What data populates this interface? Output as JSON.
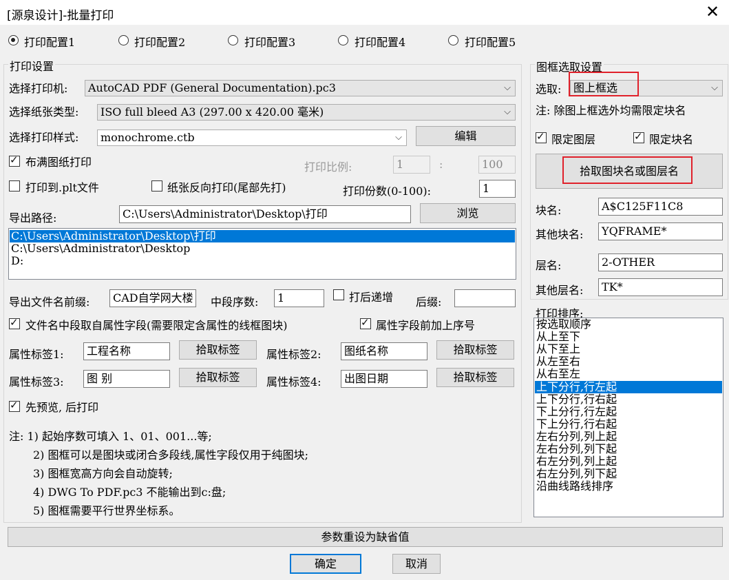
{
  "window": {
    "title": "[源泉设计]-批量打印",
    "close_glyph": "✕"
  },
  "configs": [
    "打印配置1",
    "打印配置2",
    "打印配置3",
    "打印配置4",
    "打印配置5"
  ],
  "print_settings": {
    "title": "打印设置",
    "printer_label": "选择打印机:",
    "printer_value": "AutoCAD PDF (General Documentation).pc3",
    "paper_label": "选择纸张类型:",
    "paper_value": "ISO full bleed A3 (297.00 x 420.00 毫米)",
    "style_label": "选择打印样式:",
    "style_value": "monochrome.ctb",
    "edit_button": "编辑",
    "fit_label": "布满图纸打印",
    "scale_label": "打印比例:",
    "scale_a": "1",
    "scale_sep": ":",
    "scale_b": "100",
    "plt_label": "打印到.plt文件",
    "reverse_label": "纸张反向打印(尾部先打)",
    "copies_label": "打印份数(0-100):",
    "copies_value": "1",
    "path_label": "导出路径:",
    "path_value": "C:\\Users\\Administrator\\Desktop\\打印",
    "browse_button": "浏览",
    "path_list": [
      "C:\\Users\\Administrator\\Desktop\\打印",
      "C:\\Users\\Administrator\\Desktop",
      "D:"
    ],
    "prefix_label": "导出文件名前缀:",
    "prefix_value": "CAD自学网大楼",
    "mid_label": "中段序数:",
    "mid_value": "1",
    "increment_label": "打后递增",
    "suffix_label": "后缀:",
    "suffix_value": "",
    "attr_mid_label": "文件名中段取自属性字段(需要限定含属性的线框图块)",
    "attr_prefix_label": "属性字段前加上序号",
    "attr1_label": "属性标签1:",
    "attr1_value": "工程名称",
    "attr2_label": "属性标签2:",
    "attr2_value": "图纸名称",
    "attr3_label": "属性标签3:",
    "attr3_value": "图 别",
    "attr4_label": "属性标签4:",
    "attr4_value": "出图日期",
    "pick_tag_button": "拾取标签",
    "preview_label": "先预览, 后打印",
    "notes": [
      "注: 1) 起始序数可填入 1、01、001...等;",
      "2) 图框可以是图块或闭合多段线,属性字段仅用于纯图块;",
      "3) 图框宽高方向会自动旋转;",
      "4) DWG To PDF.pc3 不能输出到c:盘;",
      "5) 图框需要平行世界坐标系。"
    ]
  },
  "frame_select": {
    "title": "图框选取设置",
    "pick_label": "选取:",
    "pick_value": "图上框选",
    "note": "注: 除图上框选外均需限定块名",
    "limit_layer": "限定图层",
    "limit_block": "限定块名",
    "pick_names_button": "拾取图块名或图层名",
    "block_label": "块名:",
    "block_value": "A$C125F11C8",
    "other_block_label": "其他块名:",
    "other_block_value": "YQFRAME*",
    "layer_label": "层名:",
    "layer_value": "2-OTHER",
    "other_layer_label": "其他层名:",
    "other_layer_value": "TK*"
  },
  "sort": {
    "title": "打印排序:",
    "items": [
      "按选取顺序",
      "从上至下",
      "从下至上",
      "从左至右",
      "从右至左",
      "上下分行,行左起",
      "上下分行,行右起",
      "下上分行,行左起",
      "下上分行,行右起",
      "左右分列,列上起",
      "左右分列,列下起",
      "右左分列,列上起",
      "右左分列,列下起",
      "沿曲线路线排序"
    ],
    "selected_index": 5
  },
  "footer": {
    "reset_button": "参数重设为缺省值",
    "ok_button": "确定",
    "cancel_button": "取消"
  },
  "colors": {
    "selection": "#0078d7",
    "highlight_box": "#e0202a"
  }
}
